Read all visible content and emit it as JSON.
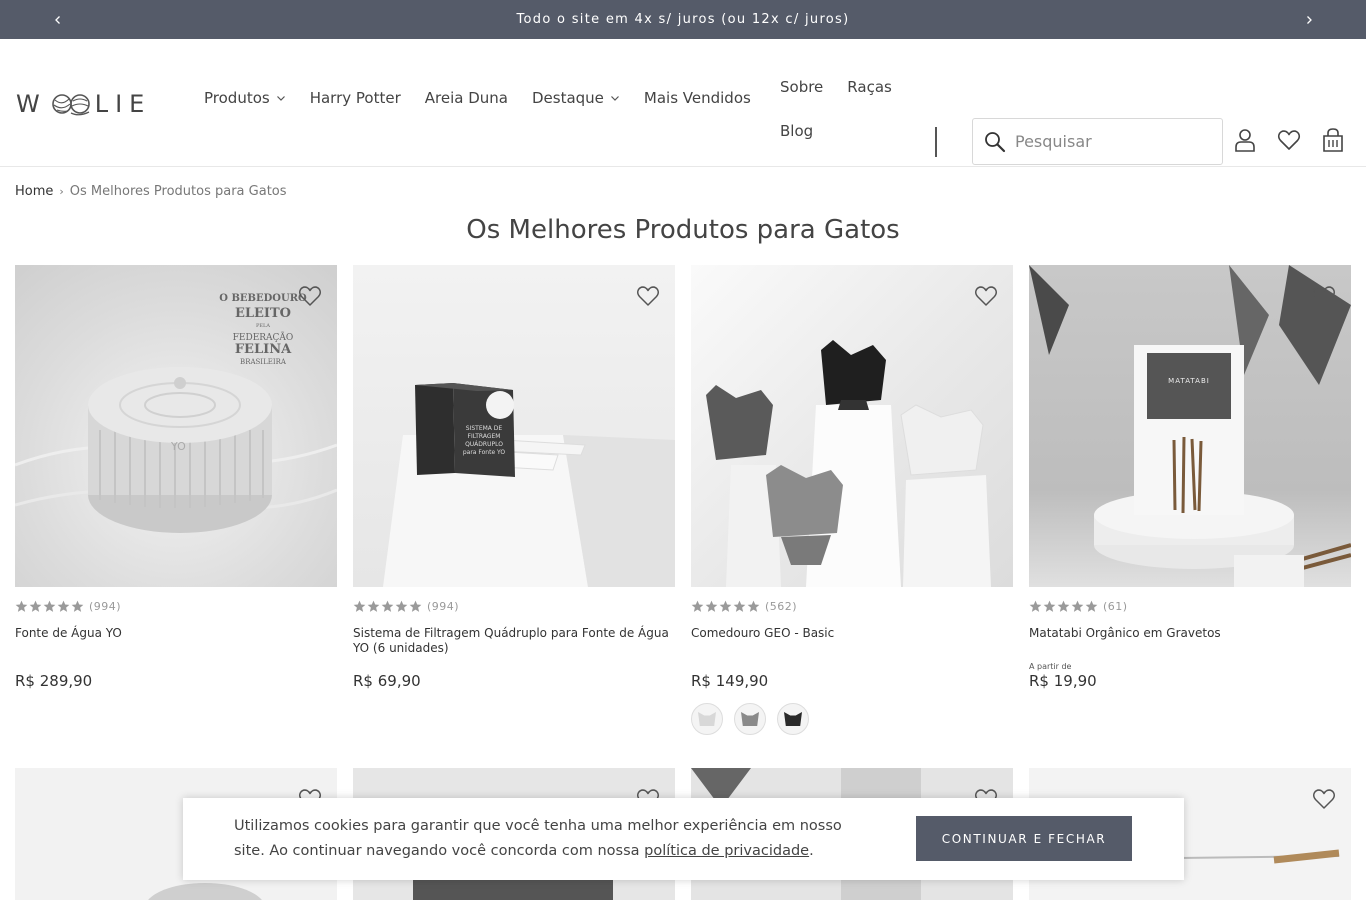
{
  "announcement": {
    "text": "Todo o site em 4x s/ juros (ou 12x c/ juros)"
  },
  "logo": {
    "text_left": "W",
    "text_right": "LIE"
  },
  "nav": {
    "items": [
      {
        "label": "Produtos",
        "has_dropdown": true
      },
      {
        "label": "Harry Potter",
        "has_dropdown": false
      },
      {
        "label": "Areia Duna",
        "has_dropdown": false
      },
      {
        "label": "Destaque",
        "has_dropdown": true
      },
      {
        "label": "Mais Vendidos",
        "has_dropdown": false
      }
    ],
    "secondary": [
      {
        "label": "Sobre"
      },
      {
        "label": "Raças"
      },
      {
        "label": "Blog"
      }
    ]
  },
  "search": {
    "placeholder": "Pesquisar"
  },
  "header_icons": [
    "account-icon",
    "wishlist-icon",
    "cart-icon"
  ],
  "breadcrumb": {
    "home": "Home",
    "current": "Os Melhores Produtos para Gatos"
  },
  "page_title": "Os Melhores Produtos para Gatos",
  "products": [
    {
      "name": "Fonte de Água YO",
      "reviews": "(994)",
      "price": "R$ 289,90",
      "from_label": "",
      "image_badge": [
        "O BEBEDOURO",
        "ELEITO",
        "PELA",
        "FEDERAÇÃO",
        "FELINA",
        "BRASILEIRA"
      ],
      "image_text": "YO"
    },
    {
      "name": "Sistema de Filtragem Quádruplo para Fonte de Água YO (6 unidades)",
      "reviews": "(994)",
      "price": "R$ 69,90",
      "from_label": "",
      "image_text": "SISTEMA DE FILTRAGEM QUÁDRUPLO para Fonte YO"
    },
    {
      "name": "Comedouro GEO - Basic",
      "reviews": "(562)",
      "price": "R$ 149,90",
      "from_label": "",
      "swatches": [
        "#d8d8d8",
        "#8a8a8a",
        "#2a2a2a"
      ]
    },
    {
      "name": "Matatabi Orgânico em Gravetos",
      "reviews": "(61)",
      "price": "R$ 19,90",
      "from_label": "A partir de",
      "image_text": "MATATABI"
    }
  ],
  "cookie": {
    "text": "Utilizamos cookies para garantir que você tenha uma melhor experiência em nosso site. Ao continuar navegando você concorda com nossa ",
    "link": "política de privacidade",
    "end": ".",
    "button": "CONTINUAR E FECHAR"
  },
  "colors": {
    "accent": "#555b69",
    "star": "#9a9a9a"
  }
}
